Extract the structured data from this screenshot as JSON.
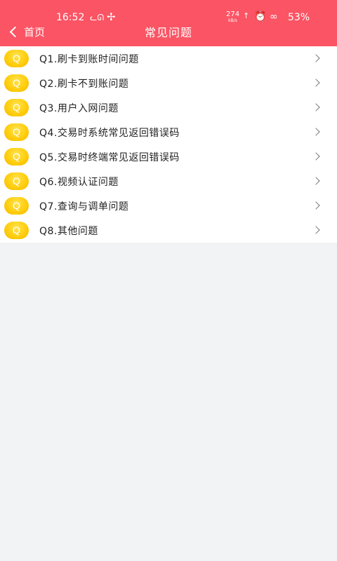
{
  "status_bar": {
    "time": "16:52",
    "net_speed": "274",
    "net_unit": "kB/s",
    "battery": "53%",
    "icons": [
      "cat-icon",
      "fan-icon",
      "upload-arrow-icon",
      "alarm-icon",
      "link-icon"
    ]
  },
  "nav": {
    "back_label": "首页",
    "title": "常见问题"
  },
  "colors": {
    "header_bg": "#fb5464",
    "badge": "#ffcc0a",
    "page_bg": "#f2f3f5"
  },
  "badge_letter": "Q",
  "questions": [
    {
      "label": "Q1.刷卡到账时间问题"
    },
    {
      "label": "Q2.刷卡不到账问题"
    },
    {
      "label": "Q3.用户入网问题"
    },
    {
      "label": "Q4.交易时系统常见返回错误码"
    },
    {
      "label": "Q5.交易时终端常见返回错误码"
    },
    {
      "label": "Q6.视频认证问题"
    },
    {
      "label": "Q7.查询与调单问题"
    },
    {
      "label": "Q8.其他问题"
    }
  ]
}
